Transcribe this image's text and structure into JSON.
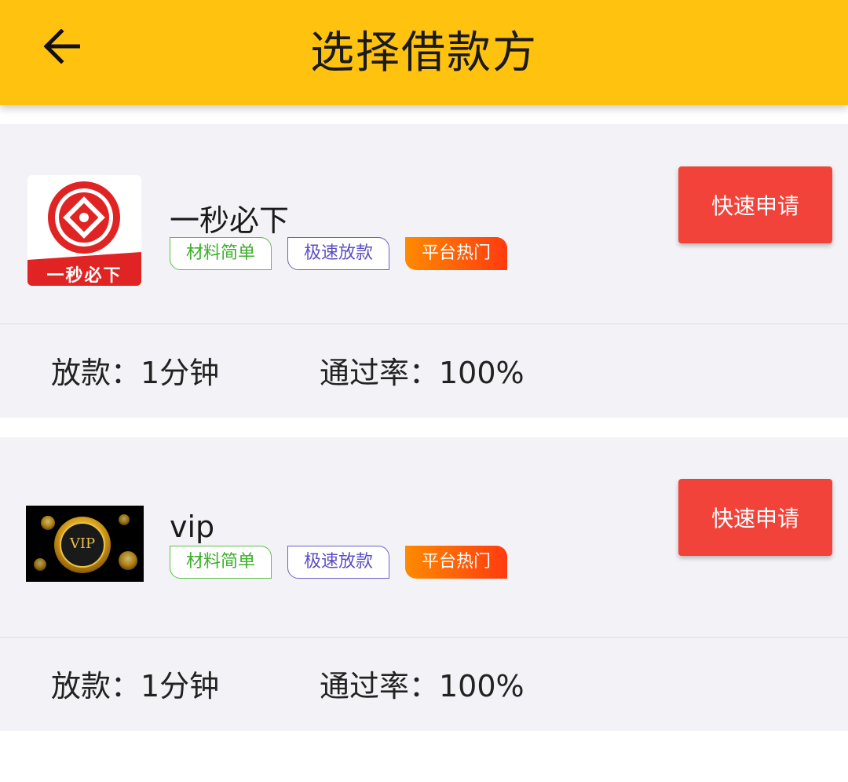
{
  "header": {
    "title": "选择借款方",
    "back_icon": "arrow-left-icon"
  },
  "lenders": [
    {
      "name": "一秒必下",
      "logo_text": "一秒必下",
      "tags": [
        "材料简单",
        "极速放款",
        "平台热门"
      ],
      "button_label": "快速申请",
      "loan_time": "放款：1分钟",
      "pass_rate": "通过率：100%"
    },
    {
      "name": "vip",
      "logo_text": "VIP",
      "tags": [
        "材料简单",
        "极速放款",
        "平台热门"
      ],
      "button_label": "快速申请",
      "loan_time": "放款：1分钟",
      "pass_rate": "通过率：100%"
    }
  ],
  "colors": {
    "header": "#FFC20E",
    "button": "#F2433A",
    "card_bg": "#F3F3F7"
  }
}
